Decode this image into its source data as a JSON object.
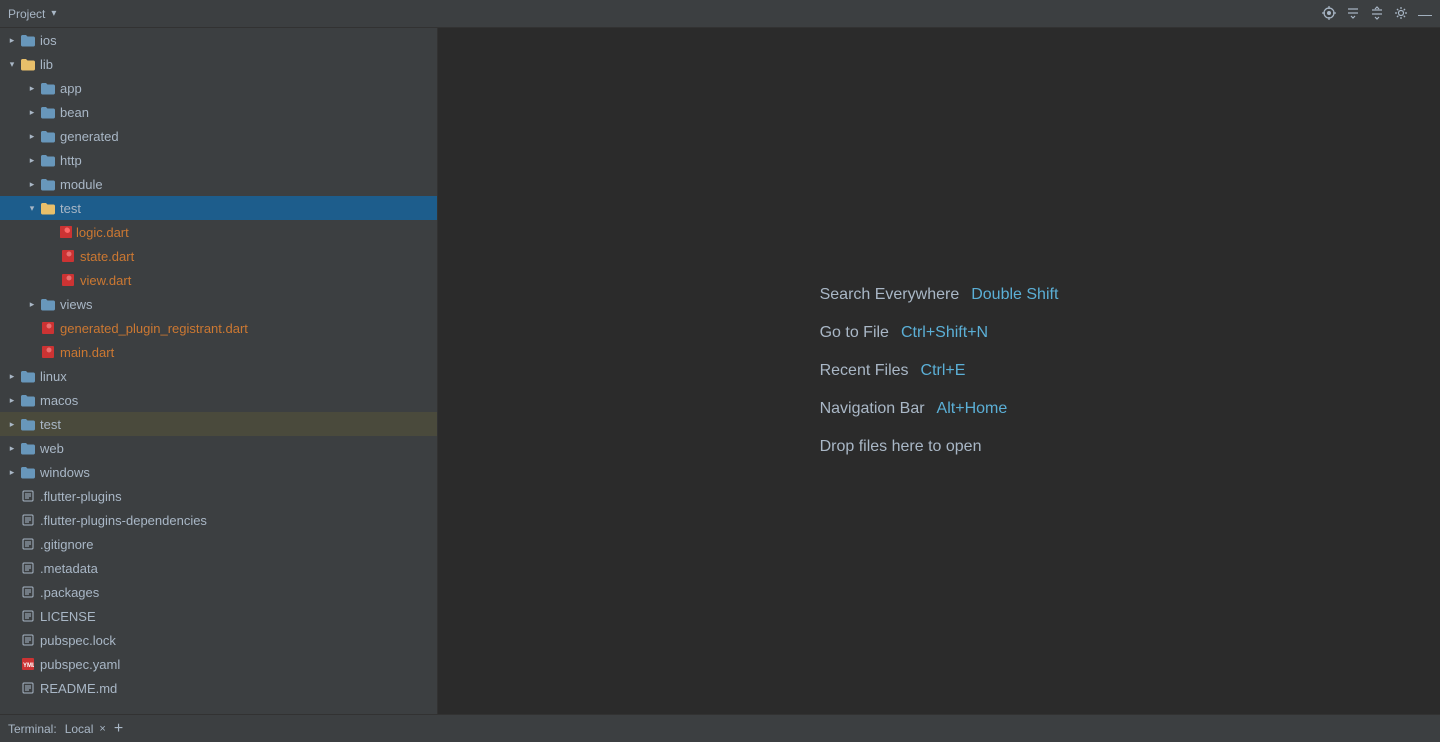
{
  "topbar": {
    "title": "Project",
    "icons": {
      "target": "⊕",
      "collapse_all": "≡",
      "expand_all": "≡",
      "settings": "⚙",
      "close": "—"
    }
  },
  "sidebar": {
    "items": [
      {
        "id": "ios",
        "label": "ios",
        "type": "folder",
        "depth": 0,
        "state": "closed",
        "selected": false
      },
      {
        "id": "lib",
        "label": "lib",
        "type": "folder",
        "depth": 0,
        "state": "open",
        "selected": false
      },
      {
        "id": "app",
        "label": "app",
        "type": "folder",
        "depth": 1,
        "state": "closed",
        "selected": false
      },
      {
        "id": "bean",
        "label": "bean",
        "type": "folder",
        "depth": 1,
        "state": "closed",
        "selected": false
      },
      {
        "id": "generated",
        "label": "generated",
        "type": "folder",
        "depth": 1,
        "state": "closed",
        "selected": false
      },
      {
        "id": "http",
        "label": "http",
        "type": "folder",
        "depth": 1,
        "state": "closed",
        "selected": false
      },
      {
        "id": "module",
        "label": "module",
        "type": "folder",
        "depth": 1,
        "state": "closed",
        "selected": false
      },
      {
        "id": "test",
        "label": "test",
        "type": "folder",
        "depth": 1,
        "state": "open",
        "selected": true
      },
      {
        "id": "logic.dart",
        "label": "logic.dart",
        "type": "dart",
        "depth": 2,
        "selected": false
      },
      {
        "id": "state.dart",
        "label": "state.dart",
        "type": "dart",
        "depth": 2,
        "selected": false
      },
      {
        "id": "view.dart",
        "label": "view.dart",
        "type": "dart",
        "depth": 2,
        "selected": false
      },
      {
        "id": "views",
        "label": "views",
        "type": "folder",
        "depth": 1,
        "state": "closed",
        "selected": false
      },
      {
        "id": "generated_plugin_registrant.dart",
        "label": "generated_plugin_registrant.dart",
        "type": "dart-generated",
        "depth": 1,
        "selected": false
      },
      {
        "id": "main.dart",
        "label": "main.dart",
        "type": "dart",
        "depth": 1,
        "selected": false
      },
      {
        "id": "linux",
        "label": "linux",
        "type": "folder",
        "depth": 0,
        "state": "closed",
        "selected": false
      },
      {
        "id": "macos",
        "label": "macos",
        "type": "folder",
        "depth": 0,
        "state": "closed",
        "selected": false
      },
      {
        "id": "test-root",
        "label": "test",
        "type": "folder",
        "depth": 0,
        "state": "closed",
        "selected": false,
        "alt": true
      },
      {
        "id": "web",
        "label": "web",
        "type": "folder",
        "depth": 0,
        "state": "closed",
        "selected": false
      },
      {
        "id": "windows",
        "label": "windows",
        "type": "folder",
        "depth": 0,
        "state": "closed",
        "selected": false
      },
      {
        "id": ".flutter-plugins",
        "label": ".flutter-plugins",
        "type": "text",
        "depth": 0,
        "selected": false
      },
      {
        "id": ".flutter-plugins-dependencies",
        "label": ".flutter-plugins-dependencies",
        "type": "text",
        "depth": 0,
        "selected": false
      },
      {
        "id": ".gitignore",
        "label": ".gitignore",
        "type": "text",
        "depth": 0,
        "selected": false
      },
      {
        "id": ".metadata",
        "label": ".metadata",
        "type": "text",
        "depth": 0,
        "selected": false
      },
      {
        "id": ".packages",
        "label": ".packages",
        "type": "text",
        "depth": 0,
        "selected": false
      },
      {
        "id": "LICENSE",
        "label": "LICENSE",
        "type": "text",
        "depth": 0,
        "selected": false
      },
      {
        "id": "pubspec.lock",
        "label": "pubspec.lock",
        "type": "text",
        "depth": 0,
        "selected": false
      },
      {
        "id": "pubspec.yaml",
        "label": "pubspec.yaml",
        "type": "yaml",
        "depth": 0,
        "selected": false
      },
      {
        "id": "README.md",
        "label": "README.md",
        "type": "text",
        "depth": 0,
        "selected": false
      }
    ]
  },
  "welcome": {
    "rows": [
      {
        "label": "Search Everywhere",
        "shortcut": "Double Shift"
      },
      {
        "label": "Go to File",
        "shortcut": "Ctrl+Shift+N"
      },
      {
        "label": "Recent Files",
        "shortcut": "Ctrl+E"
      },
      {
        "label": "Navigation Bar",
        "shortcut": "Alt+Home"
      }
    ],
    "drop_text": "Drop files here to open"
  },
  "terminal": {
    "label": "Terminal:",
    "tab_label": "Local",
    "close_icon": "×",
    "add_icon": "+"
  }
}
